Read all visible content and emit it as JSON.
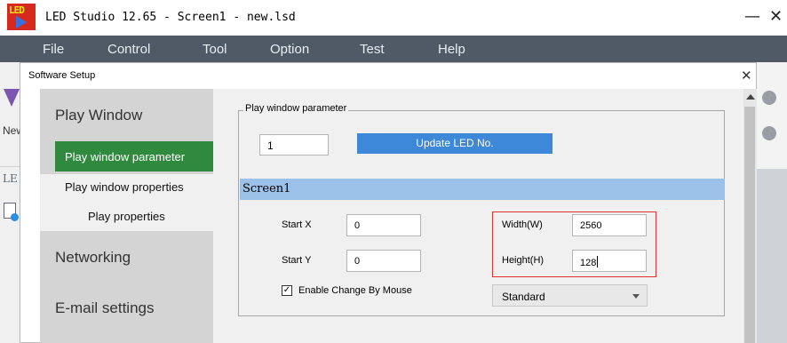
{
  "app": {
    "logo_text": "LED",
    "title": "LED Studio 12.65 - Screen1 - new.lsd",
    "minimize": "—",
    "close": "✕"
  },
  "menu": [
    "File",
    "Control",
    "Tool",
    "Option",
    "Test",
    "Help"
  ],
  "background": {
    "new_label": "New",
    "tab_label": "LE"
  },
  "dialog": {
    "title": "Software Setup",
    "close": "✕",
    "nav": {
      "play_window": "Play Window",
      "items": [
        "Play window parameter",
        "Play window properties",
        "Play properties"
      ],
      "networking": "Networking",
      "email": "E-mail settings"
    },
    "group_title": "Play window parameter",
    "led_no_value": "1",
    "update_button": "Update LED No.",
    "screen_label": "Screen1",
    "start_x_label": "Start X",
    "start_x_value": "0",
    "start_y_label": "Start Y",
    "start_y_value": "0",
    "width_label": "Width(W)",
    "width_value": "2560",
    "height_label": "Height(H)",
    "height_value": "128",
    "checkbox_mark": "✓",
    "checkbox_label": "Enable Change By Mouse",
    "mode_selected": "Standard"
  }
}
